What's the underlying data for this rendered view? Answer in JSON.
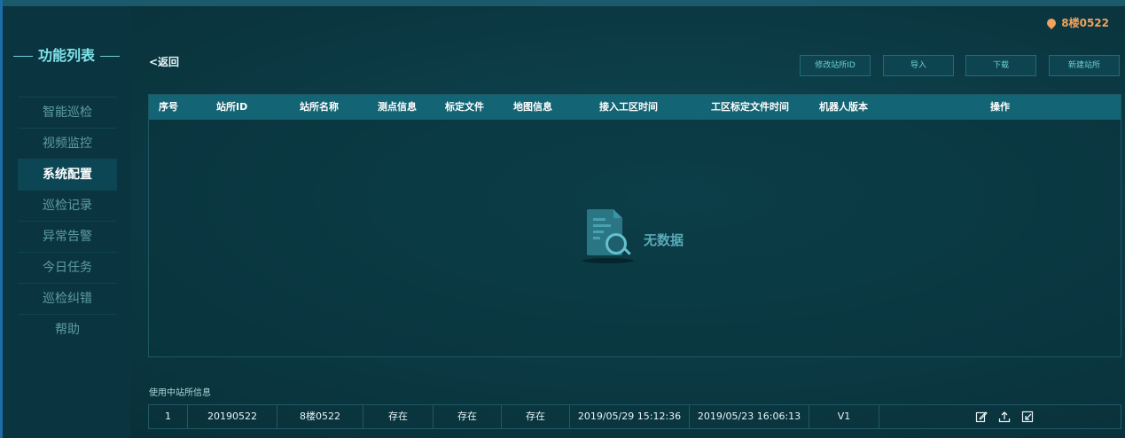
{
  "sidebar": {
    "title": "功能列表",
    "items": [
      {
        "label": "智能巡检",
        "active": false
      },
      {
        "label": "视频监控",
        "active": false
      },
      {
        "label": "系统配置",
        "active": true
      },
      {
        "label": "巡检记录",
        "active": false
      },
      {
        "label": "异常告警",
        "active": false
      },
      {
        "label": "今日任务",
        "active": false
      },
      {
        "label": "巡检纠错",
        "active": false
      },
      {
        "label": "帮助",
        "active": false
      }
    ]
  },
  "header": {
    "location": "8楼0522"
  },
  "toolbar": {
    "back_label": "<返回",
    "modify_id_label": "修改站所ID",
    "import_label": "导入",
    "download_label": "下载",
    "new_station_label": "新建站所"
  },
  "table": {
    "columns": [
      "序号",
      "站所ID",
      "站所名称",
      "测点信息",
      "标定文件",
      "地图信息",
      "接入工区时间",
      "工区标定文件时间",
      "机器人版本",
      "操作"
    ],
    "empty_text": "无数据"
  },
  "current_station": {
    "label": "使用中站所信息",
    "row": {
      "index": "1",
      "station_id": "20190522",
      "station_name": "8楼0522",
      "measure_info": "存在",
      "calib_file": "存在",
      "map_info": "存在",
      "access_time": "2019/05/29 15:12:36",
      "calib_time": "2019/05/23 16:06:13",
      "robot_version": "V1"
    },
    "actions": [
      "edit-icon",
      "upload-icon",
      "import-icon"
    ]
  },
  "colors": {
    "background": "#0b3842",
    "sidebar": "#0a3540",
    "accent": "#7ee2e9",
    "table_header": "#136474",
    "location": "#f2a25c"
  }
}
